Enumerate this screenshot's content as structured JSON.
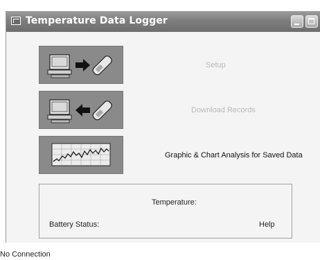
{
  "window": {
    "title": "Temperature Data Logger"
  },
  "actions": [
    {
      "label": "Setup",
      "enabled": false,
      "icon": "computer-to-logger-icon"
    },
    {
      "label": "Download Records",
      "enabled": false,
      "icon": "logger-to-computer-icon"
    },
    {
      "label": "Graphic & Chart Analysis for Saved Data",
      "enabled": true,
      "icon": "chart-graph-icon"
    }
  ],
  "status_panel": {
    "temperature_label": "Temperature:",
    "battery_label": "Battery Status:",
    "help_label": "Help"
  },
  "statusbar": {
    "connection": "No Connection"
  }
}
